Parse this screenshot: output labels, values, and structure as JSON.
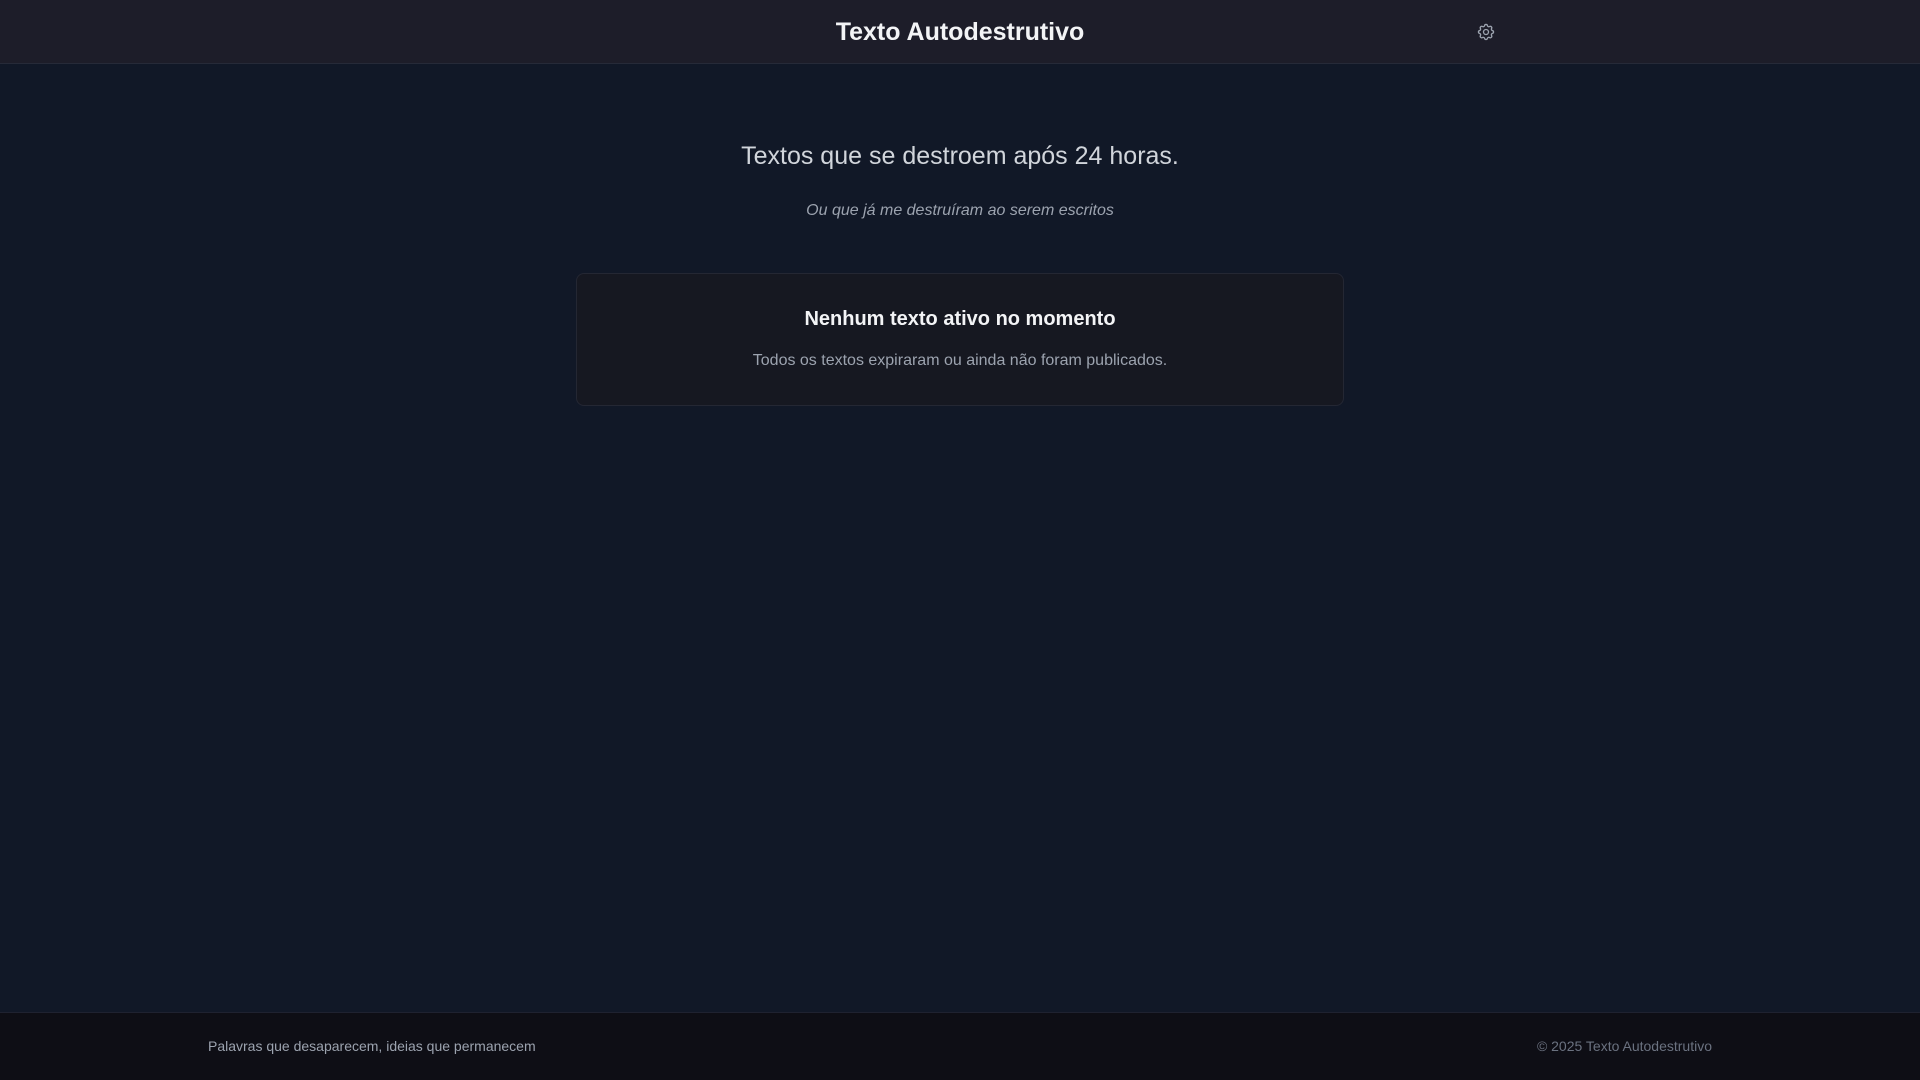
{
  "header": {
    "title": "Texto Autodestrutivo",
    "settings_icon": "gear-icon"
  },
  "hero": {
    "title": "Textos que se destroem após 24 horas.",
    "subtitle": "Ou que já me destruíram ao serem escritos"
  },
  "empty_state": {
    "title": "Nenhum texto ativo no momento",
    "description": "Todos os textos expiraram ou ainda não foram publicados."
  },
  "footer": {
    "tagline": "Palavras que desaparecem, ideias que permanecem",
    "copyright": "© 2025 Texto Autodestrutivo"
  },
  "colors": {
    "background": "#111827",
    "header_bg": "#1d1d29",
    "card_bg": "#161821",
    "footer_bg": "#0e0e15",
    "text_primary": "#f3f4f6",
    "text_secondary": "#9ca3af"
  }
}
